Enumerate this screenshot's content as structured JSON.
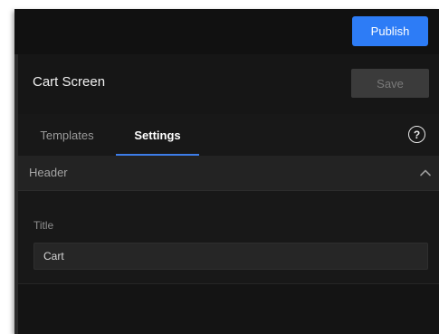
{
  "topbar": {
    "publish_label": "Publish",
    "accent_color": "#2d7cf6"
  },
  "screen": {
    "title": "Cart Screen",
    "save_label": "Save"
  },
  "tabs": [
    {
      "label": "Templates",
      "active": false
    },
    {
      "label": "Settings",
      "active": true
    }
  ],
  "help": {
    "icon": "help-circle-icon",
    "glyph": "?"
  },
  "section": {
    "label": "Header",
    "expanded": true,
    "icon": "chevron-up-icon",
    "fields": {
      "title_label": "Title",
      "title_value": "Cart"
    }
  }
}
